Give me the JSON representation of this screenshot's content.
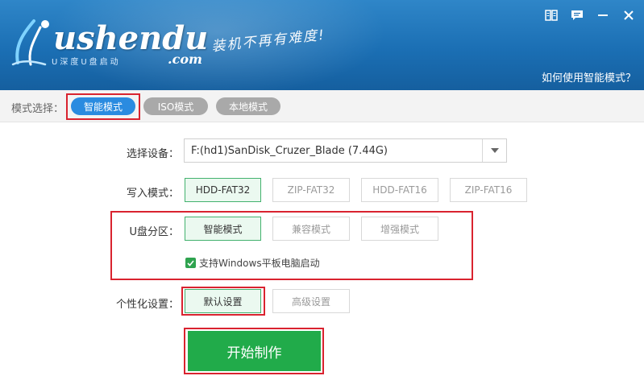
{
  "header": {
    "logo_text": "ushendu",
    "logo_sub": "U深度U盘启动",
    "logo_com": ".com",
    "slogan": "装机不再有难度!",
    "help_link": "如何使用智能模式？",
    "controls": [
      "manual-icon",
      "feedback-icon",
      "minimize-icon",
      "close-icon"
    ]
  },
  "mode_bar": {
    "label": "模式选择：",
    "tabs": [
      {
        "label": "智能模式",
        "active": true
      },
      {
        "label": "ISO模式",
        "active": false
      },
      {
        "label": "本地模式",
        "active": false
      }
    ]
  },
  "device": {
    "label": "选择设备：",
    "value": "F:(hd1)SanDisk_Cruzer_Blade (7.44G)"
  },
  "write_mode": {
    "label": "写入模式：",
    "options": [
      {
        "label": "HDD-FAT32",
        "selected": true
      },
      {
        "label": "ZIP-FAT32",
        "selected": false
      },
      {
        "label": "HDD-FAT16",
        "selected": false
      },
      {
        "label": "ZIP-FAT16",
        "selected": false
      }
    ]
  },
  "partition": {
    "label": "U盘分区：",
    "options": [
      {
        "label": "智能模式",
        "selected": true
      },
      {
        "label": "兼容模式",
        "selected": false
      },
      {
        "label": "增强模式",
        "selected": false
      }
    ],
    "checkbox_label": "支持Windows平板电脑启动",
    "checkbox_checked": true
  },
  "personalize": {
    "label": "个性化设置：",
    "options": [
      {
        "label": "默认设置",
        "selected": true
      },
      {
        "label": "高级设置",
        "selected": false
      }
    ]
  },
  "start_button": "开始制作",
  "colors": {
    "header_blue": "#1b6fb4",
    "tab_active": "#2a8be0",
    "tab_inactive": "#a9a9a9",
    "selected_border": "#43b26e",
    "start_green": "#21ab4a",
    "highlight_red": "#d9232f"
  }
}
